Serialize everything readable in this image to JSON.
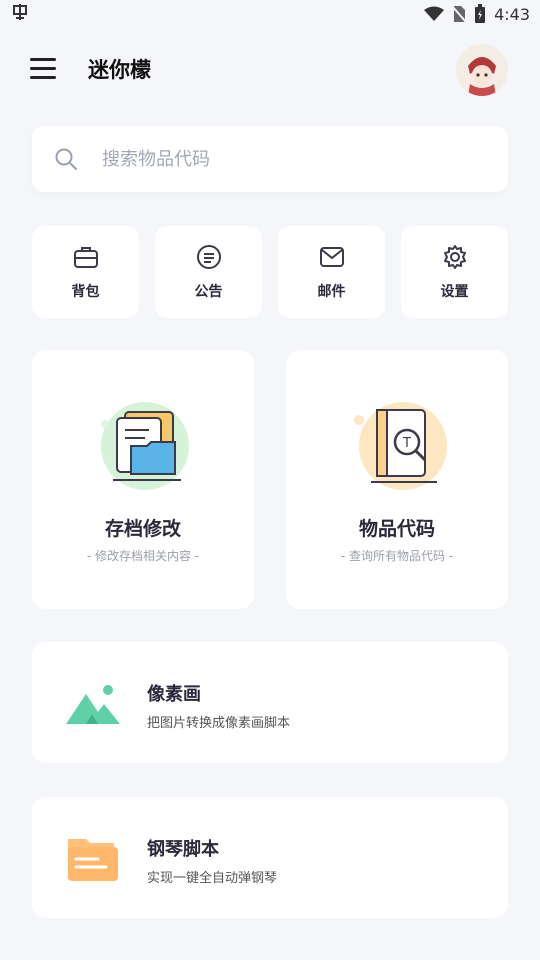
{
  "status_bar": {
    "left_icon": "bug-icon",
    "time": "4:43",
    "icons": [
      "wifi-icon",
      "no-sim-icon",
      "battery-icon"
    ]
  },
  "app_bar": {
    "title": "迷你檬",
    "menu_icon": "menu-icon",
    "avatar": "avatar"
  },
  "search": {
    "placeholder": "搜索物品代码"
  },
  "quick_actions": [
    {
      "label": "背包",
      "icon": "backpack-icon"
    },
    {
      "label": "公告",
      "icon": "announcement-icon"
    },
    {
      "label": "邮件",
      "icon": "mail-icon"
    },
    {
      "label": "设置",
      "icon": "gear-icon"
    }
  ],
  "feature_cards": [
    {
      "title": "存档修改",
      "subtitle": "- 修改存档相关内容 -",
      "icon": "save-folder-icon",
      "accent": "#5ab4e8"
    },
    {
      "title": "物品代码",
      "subtitle": "- 查询所有物品代码 -",
      "icon": "codebook-icon",
      "accent": "#f6c36c"
    }
  ],
  "list_cards": [
    {
      "title": "像素画",
      "subtitle": "把图片转换成像素画脚本",
      "icon": "mountain-image-icon",
      "accent": "#5fd0a8"
    },
    {
      "title": "钢琴脚本",
      "subtitle": "实现一键全自动弹钢琴",
      "icon": "folder-icon",
      "accent": "#ffb86b"
    }
  ]
}
